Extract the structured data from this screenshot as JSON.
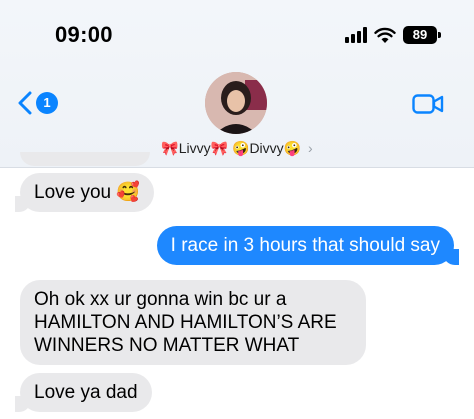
{
  "status_bar": {
    "time": "09:00",
    "battery": "89"
  },
  "nav": {
    "back_badge": "1"
  },
  "contact": {
    "name_a_prefix": "🎀",
    "name_a": "Livvy",
    "name_a_suffix": "🎀",
    "name_b_prefix": "🤪",
    "name_b": "Divvy",
    "name_b_suffix": "🤪",
    "chevron": "›"
  },
  "messages": [
    {
      "type": "received",
      "text": "Love you 🥰"
    },
    {
      "type": "sent",
      "text": "I race in 3 hours that should say"
    },
    {
      "type": "received",
      "lines": [
        "Oh ok xx ur gonna win bc ur a",
        "HAMILTON AND HAMILTON’S ARE",
        "WINNERS NO MATTER WHAT"
      ]
    },
    {
      "type": "received",
      "text": "Love ya dad"
    }
  ],
  "colors": {
    "sent_bubble": "#1e88ff",
    "received_bubble": "#e9e9eb",
    "accent": "#0a84ff"
  },
  "icons": [
    "signal-icon",
    "wifi-icon",
    "battery-icon",
    "back-chevron-icon",
    "video-call-icon",
    "chevron-right-icon"
  ]
}
